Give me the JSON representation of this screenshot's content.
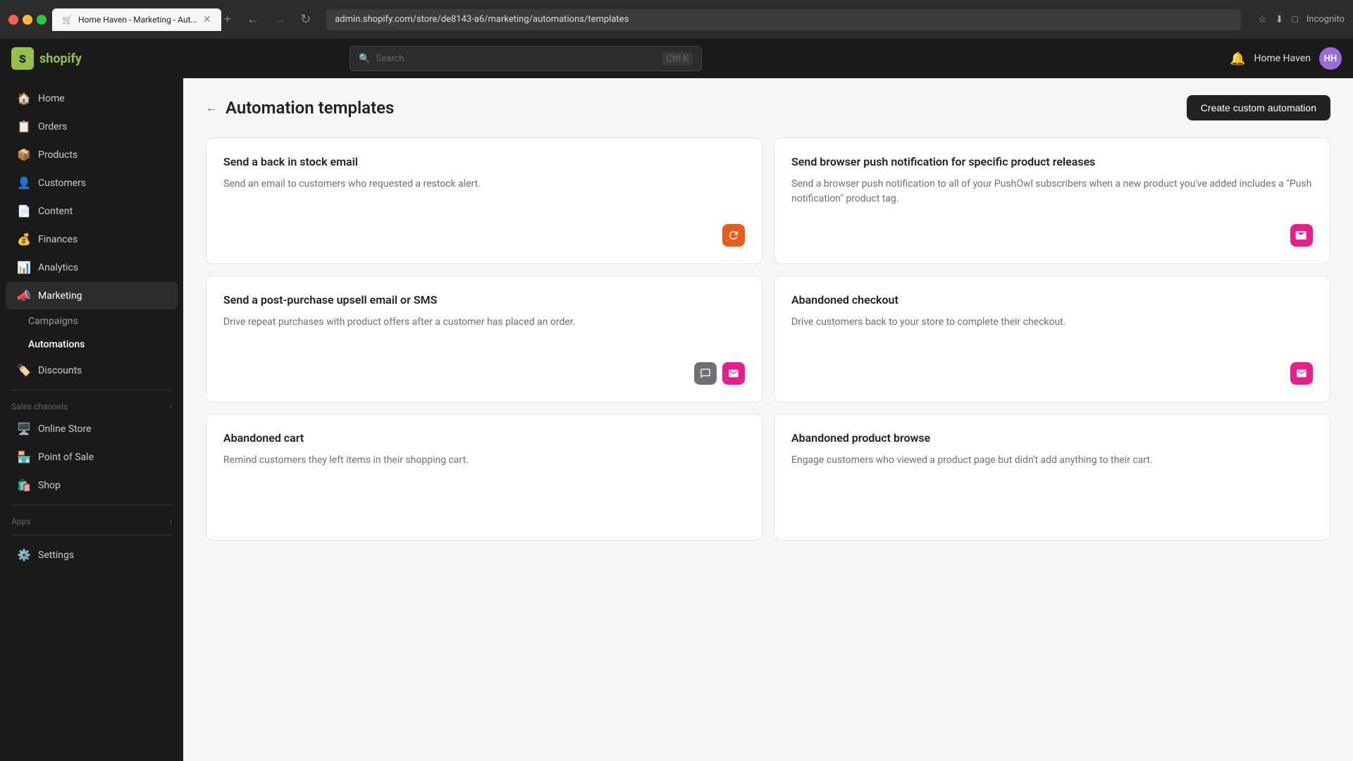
{
  "browser": {
    "tabs": [
      {
        "label": "Home Haven - Marketing - Aut...",
        "active": true,
        "favicon": "🛒"
      },
      {
        "label": "+",
        "active": false
      }
    ],
    "url": "admin.shopify.com/store/de8143-a6/marketing/automations/templates",
    "nav_back": "←",
    "nav_forward": "→",
    "reload": "↻"
  },
  "topnav": {
    "logo_text": "shopify",
    "logo_initials": "S",
    "search_placeholder": "Search",
    "search_shortcut": "Ctrl K",
    "store_name": "Home Haven",
    "avatar_initials": "HH"
  },
  "sidebar": {
    "items": [
      {
        "id": "home",
        "label": "Home",
        "icon": "🏠"
      },
      {
        "id": "orders",
        "label": "Orders",
        "icon": "📋"
      },
      {
        "id": "products",
        "label": "Products",
        "icon": "📦"
      },
      {
        "id": "customers",
        "label": "Customers",
        "icon": "👤"
      },
      {
        "id": "content",
        "label": "Content",
        "icon": "📄"
      },
      {
        "id": "finances",
        "label": "Finances",
        "icon": "💰"
      },
      {
        "id": "analytics",
        "label": "Analytics",
        "icon": "📊"
      },
      {
        "id": "marketing",
        "label": "Marketing",
        "icon": "📣",
        "active": true
      }
    ],
    "marketing_sub": [
      {
        "id": "campaigns",
        "label": "Campaigns"
      },
      {
        "id": "automations",
        "label": "Automations",
        "active": true
      }
    ],
    "items2": [
      {
        "id": "discounts",
        "label": "Discounts",
        "icon": "🏷️"
      }
    ],
    "sales_channels_label": "Sales channels",
    "sales_channels": [
      {
        "id": "online-store",
        "label": "Online Store",
        "icon": "🖥️"
      },
      {
        "id": "point-of-sale",
        "label": "Point of Sale",
        "icon": "🏪"
      },
      {
        "id": "shop",
        "label": "Shop",
        "icon": "🛍️"
      }
    ],
    "apps_label": "Apps",
    "settings_label": "Settings",
    "settings_icon": "⚙️"
  },
  "page": {
    "back_label": "←",
    "title": "Automation templates",
    "create_button_label": "Create custom automation"
  },
  "templates": [
    {
      "id": "back-in-stock",
      "title": "Send a back in stock email",
      "description": "Send an email to customers who requested a restock alert.",
      "icons": [
        {
          "type": "orange",
          "glyph": "↩"
        }
      ]
    },
    {
      "id": "browser-push",
      "title": "Send browser push notification for specific product releases",
      "description": "Send a browser push notification to all of your PushOwl subscribers when a new product you've added includes a \"Push notification\" product tag.",
      "icons": [
        {
          "type": "pink",
          "glyph": "🔔"
        }
      ]
    },
    {
      "id": "post-purchase",
      "title": "Send a post-purchase upsell email or SMS",
      "description": "Drive repeat purchases with product offers after a customer has placed an order.",
      "icons": [
        {
          "type": "sms",
          "glyph": "💬"
        },
        {
          "type": "email",
          "glyph": "✉"
        }
      ]
    },
    {
      "id": "abandoned-checkout",
      "title": "Abandoned checkout",
      "description": "Drive customers back to your store to complete their checkout.",
      "icons": [
        {
          "type": "email",
          "glyph": "✉"
        }
      ]
    },
    {
      "id": "abandoned-cart",
      "title": "Abandoned cart",
      "description": "Remind customers they left items in their shopping cart.",
      "icons": []
    },
    {
      "id": "abandoned-browse",
      "title": "Abandoned product browse",
      "description": "Engage customers who viewed a product page but didn't add anything to their cart.",
      "icons": []
    }
  ]
}
